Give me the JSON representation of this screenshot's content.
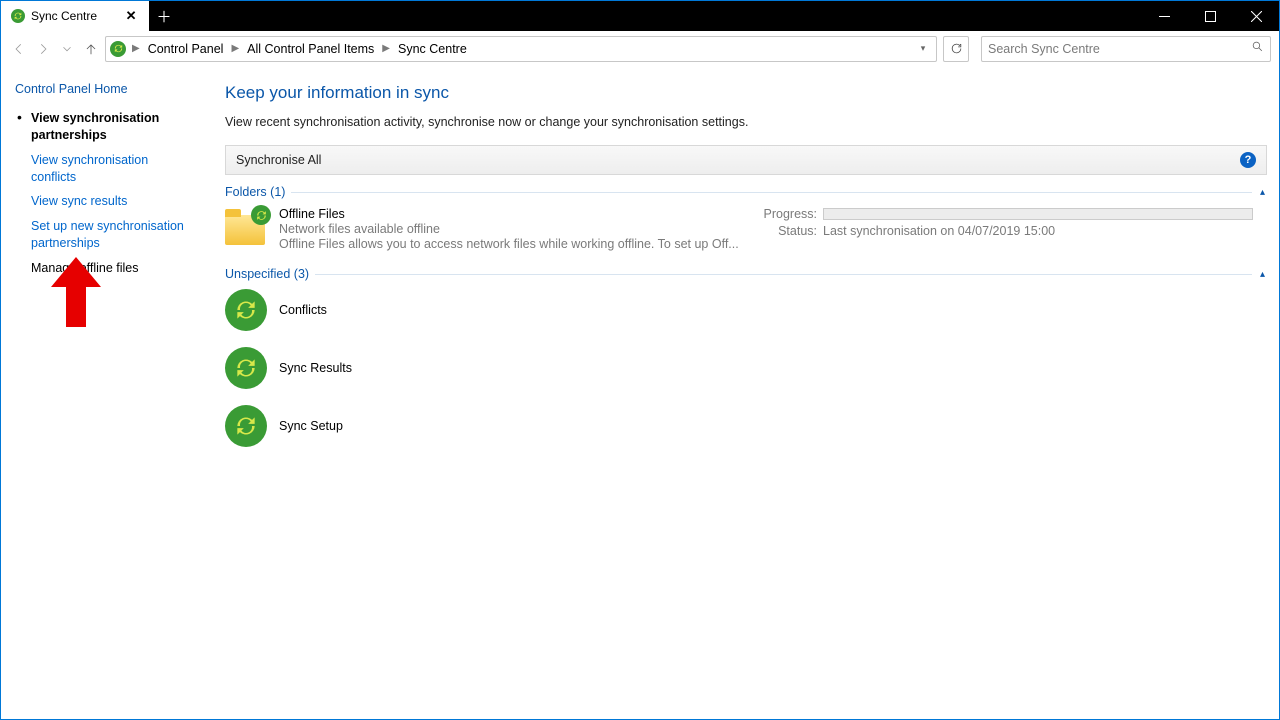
{
  "tab": {
    "title": "Sync Centre"
  },
  "breadcrumb": {
    "a": "Control Panel",
    "b": "All Control Panel Items",
    "c": "Sync Centre"
  },
  "search": {
    "placeholder": "Search Sync Centre"
  },
  "sidebar": {
    "home": "Control Panel Home",
    "items": [
      {
        "label": "View synchronisation partnerships"
      },
      {
        "label": "View synchronisation conflicts"
      },
      {
        "label": "View sync results"
      },
      {
        "label": "Set up new synchronisation partnerships"
      },
      {
        "label": "Manage offline files"
      }
    ]
  },
  "page": {
    "title": "Keep your information in sync",
    "subtitle": "View recent synchronisation activity, synchronise now or change your synchronisation settings."
  },
  "toolbar": {
    "sync_all": "Synchronise All"
  },
  "groups": {
    "folders_header": "Folders (1)",
    "unspecified_header": "Unspecified (3)"
  },
  "offline": {
    "name": "Offline Files",
    "line1": "Network files available offline",
    "line2": "Offline Files allows you to access network files while working offline. To set up Off...",
    "progress_label": "Progress:",
    "status_label": "Status:",
    "status_value": "Last synchronisation on 04/07/2019 15:00"
  },
  "unspecified": {
    "a": "Conflicts",
    "b": "Sync Results",
    "c": "Sync Setup"
  }
}
